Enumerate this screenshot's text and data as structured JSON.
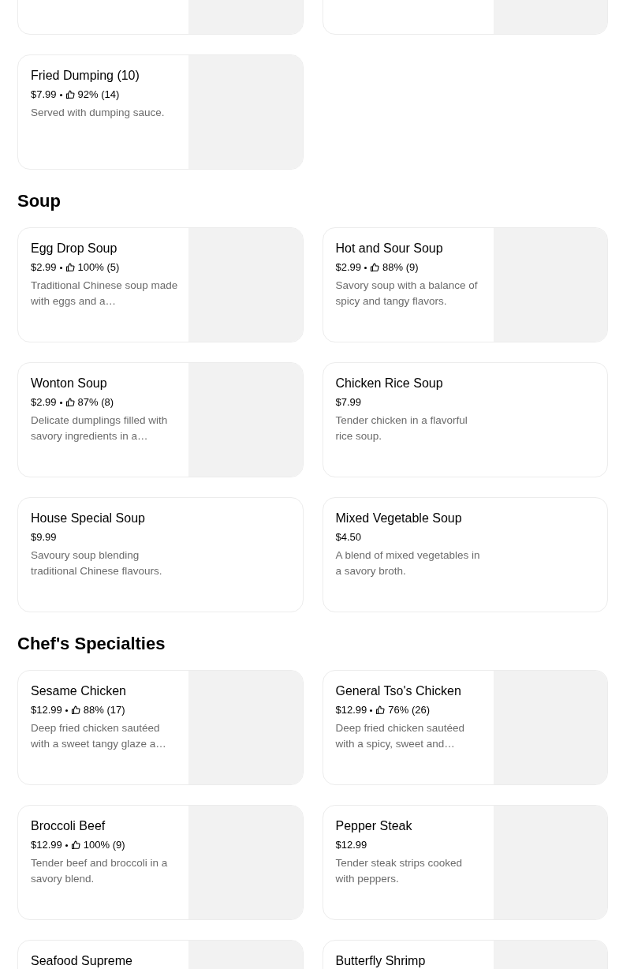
{
  "sections": [
    {
      "items": [
        {
          "has_image": true
        },
        {
          "has_image": true
        },
        {
          "title": "Fried Dumping (10)",
          "price": "$7.99",
          "rating": "92% (14)",
          "description": "Served with dumping sauce.",
          "has_image": true
        }
      ]
    },
    {
      "title": "Soup",
      "items": [
        {
          "title": "Egg Drop Soup",
          "price": "$2.99",
          "rating": "100% (5)",
          "description": "Traditional Chinese soup made with eggs and a…",
          "has_image": true
        },
        {
          "title": "Hot and Sour Soup",
          "price": "$2.99",
          "rating": "88% (9)",
          "description": "Savory soup with a balance of spicy and tangy flavors.",
          "has_image": true
        },
        {
          "title": "Wonton Soup",
          "price": "$2.99",
          "rating": "87% (8)",
          "description": "Delicate dumplings filled with savory ingredients in a…",
          "has_image": true
        },
        {
          "title": "Chicken Rice Soup",
          "price": "$7.99",
          "description": "Tender chicken in a flavorful rice soup.",
          "has_image": false
        },
        {
          "title": "House Special Soup",
          "price": "$9.99",
          "description": "Savoury soup blending traditional Chinese flavours.",
          "has_image": false
        },
        {
          "title": "Mixed Vegetable Soup",
          "price": "$4.50",
          "description": "A blend of mixed vegetables in a savory broth.",
          "has_image": false
        }
      ]
    },
    {
      "title": "Chef's Specialties",
      "items": [
        {
          "title": "Sesame Chicken",
          "price": "$12.99",
          "rating": "88% (17)",
          "description": "Deep fried chicken sautéed with a sweet tangy glaze a…",
          "has_image": true
        },
        {
          "title": "General Tso's Chicken",
          "price": "$12.99",
          "rating": "76% (26)",
          "description": "Deep fried chicken sautéed with a spicy, sweet and…",
          "has_image": true
        },
        {
          "title": "Broccoli Beef",
          "price": "$12.99",
          "rating": "100% (9)",
          "description": "Tender beef and broccoli in a savory blend.",
          "has_image": true
        },
        {
          "title": "Pepper Steak",
          "price": "$12.99",
          "description": "Tender steak strips cooked with peppers.",
          "has_image": true
        },
        {
          "title": "Seafood Supreme",
          "has_image": true
        },
        {
          "title": "Butterfly Shrimp",
          "has_image": true
        }
      ]
    }
  ]
}
